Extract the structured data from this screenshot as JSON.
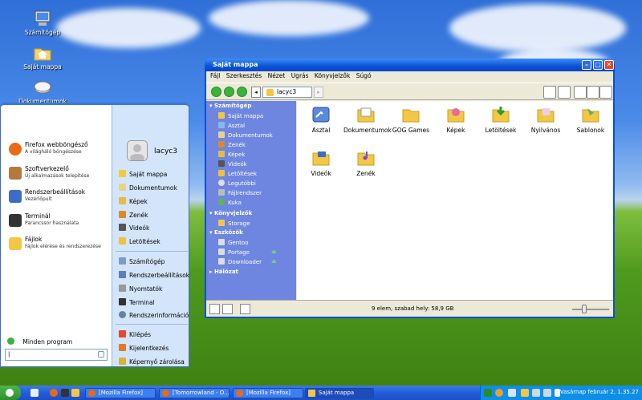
{
  "desktop": {
    "icons": [
      {
        "label": "Számítógép",
        "icon": "computer-icon"
      },
      {
        "label": "Saját mappa",
        "icon": "home-folder-icon"
      },
      {
        "label": "Dokumentumok",
        "icon": "documents-folder-icon"
      }
    ]
  },
  "startmenu": {
    "apps": [
      {
        "title": "Firefox webböngésző",
        "subtitle": "A világháló böngészése",
        "icon": "firefox-icon",
        "color": "#e86a17"
      },
      {
        "title": "Szoftverkezelő",
        "subtitle": "Új alkalmazások telepítése",
        "icon": "software-manager-icon",
        "color": "#b37a3c"
      },
      {
        "title": "Rendszerbeállítások",
        "subtitle": "Vezérlőpult",
        "icon": "control-panel-icon",
        "color": "#3a6cc9"
      },
      {
        "title": "Terminál",
        "subtitle": "Parancssor használata",
        "icon": "terminal-icon",
        "color": "#333333"
      },
      {
        "title": "Fájlok",
        "subtitle": "Fájlok elérése és rendszerezése",
        "icon": "folder-icon",
        "color": "#f2c744"
      }
    ],
    "all_programs": "Minden program",
    "user": "lacyc3",
    "places": [
      {
        "label": "Saját mappa",
        "icon": "home-icon"
      },
      {
        "label": "Dokumentumok",
        "icon": "documents-icon"
      },
      {
        "label": "Képek",
        "icon": "pictures-icon"
      },
      {
        "label": "Zenék",
        "icon": "music-icon"
      },
      {
        "label": "Videók",
        "icon": "videos-icon"
      },
      {
        "label": "Letöltések",
        "icon": "downloads-icon"
      }
    ],
    "system": [
      {
        "label": "Számítógép",
        "icon": "computer-icon"
      },
      {
        "label": "Rendszerbeállítások",
        "icon": "settings-icon"
      },
      {
        "label": "Nyomtatók",
        "icon": "printer-icon"
      },
      {
        "label": "Terminal",
        "icon": "terminal-icon"
      },
      {
        "label": "Rendszerinformációk",
        "icon": "info-icon"
      }
    ],
    "session": [
      {
        "label": "Kilépés",
        "icon": "logout-icon"
      },
      {
        "label": "Kijelentkezés",
        "icon": "switch-user-icon"
      },
      {
        "label": "Képernyő zárolása",
        "icon": "lock-icon"
      }
    ],
    "search_value": "|"
  },
  "window": {
    "title": "Saját mappa",
    "menu": [
      "Fájl",
      "Szerkesztés",
      "Nézet",
      "Ugrás",
      "Könyvjelzők",
      "Súgó"
    ],
    "location": "lacyc3",
    "sidebar": {
      "sections": [
        {
          "header": "Számítógép",
          "items": [
            "Saját mappa",
            "Asztal",
            "Dokumentumok",
            "Zenék",
            "Képek",
            "Videók",
            "Letöltések",
            "Legutóbbi",
            "Fájlrendszer",
            "Kuka"
          ]
        },
        {
          "header": "Könyvjelzők",
          "items": [
            "Storage"
          ]
        },
        {
          "header": "Eszközök",
          "items": [
            "Gentoo",
            "Portage",
            "Downloader"
          ]
        },
        {
          "header": "Hálózat",
          "items": []
        }
      ]
    },
    "files": [
      "Asztal",
      "Dokumentumok",
      "GOG Games",
      "Képek",
      "Letöltések",
      "Nyilvános",
      "Sablonok",
      "Videók",
      "Zenék"
    ],
    "status": "9 elem, szabad hely: 58,9 GB"
  },
  "taskbar": {
    "tasks": [
      "[Mozilla Firefox]",
      "[Tomorrowland - O...",
      "[Mozilla Firefox]",
      "Saját mappa"
    ],
    "clock": "Vasárnap február 2, 1.35.27"
  },
  "colors": {
    "titlebar": "#0a52d8",
    "sidebar": "#6e86e0",
    "taskbar": "#245dd8",
    "start": "#2f8f2d"
  }
}
